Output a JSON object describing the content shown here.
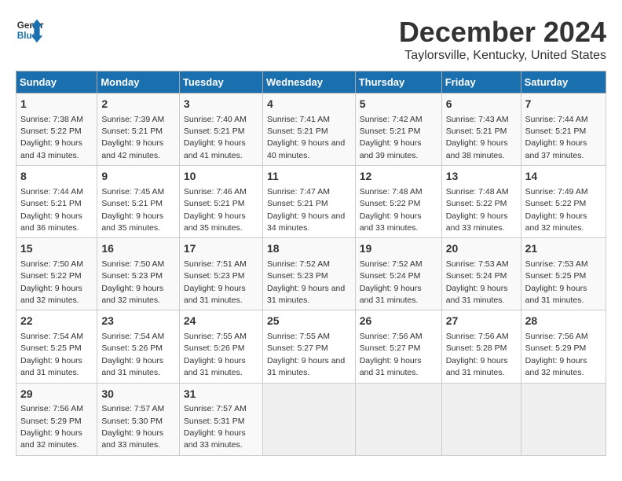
{
  "logo": {
    "text_general": "General",
    "text_blue": "Blue"
  },
  "title": "December 2024",
  "subtitle": "Taylorsville, Kentucky, United States",
  "days_of_week": [
    "Sunday",
    "Monday",
    "Tuesday",
    "Wednesday",
    "Thursday",
    "Friday",
    "Saturday"
  ],
  "weeks": [
    [
      {
        "day": "1",
        "sunrise": "Sunrise: 7:38 AM",
        "sunset": "Sunset: 5:22 PM",
        "daylight": "Daylight: 9 hours and 43 minutes."
      },
      {
        "day": "2",
        "sunrise": "Sunrise: 7:39 AM",
        "sunset": "Sunset: 5:21 PM",
        "daylight": "Daylight: 9 hours and 42 minutes."
      },
      {
        "day": "3",
        "sunrise": "Sunrise: 7:40 AM",
        "sunset": "Sunset: 5:21 PM",
        "daylight": "Daylight: 9 hours and 41 minutes."
      },
      {
        "day": "4",
        "sunrise": "Sunrise: 7:41 AM",
        "sunset": "Sunset: 5:21 PM",
        "daylight": "Daylight: 9 hours and 40 minutes."
      },
      {
        "day": "5",
        "sunrise": "Sunrise: 7:42 AM",
        "sunset": "Sunset: 5:21 PM",
        "daylight": "Daylight: 9 hours and 39 minutes."
      },
      {
        "day": "6",
        "sunrise": "Sunrise: 7:43 AM",
        "sunset": "Sunset: 5:21 PM",
        "daylight": "Daylight: 9 hours and 38 minutes."
      },
      {
        "day": "7",
        "sunrise": "Sunrise: 7:44 AM",
        "sunset": "Sunset: 5:21 PM",
        "daylight": "Daylight: 9 hours and 37 minutes."
      }
    ],
    [
      {
        "day": "8",
        "sunrise": "Sunrise: 7:44 AM",
        "sunset": "Sunset: 5:21 PM",
        "daylight": "Daylight: 9 hours and 36 minutes."
      },
      {
        "day": "9",
        "sunrise": "Sunrise: 7:45 AM",
        "sunset": "Sunset: 5:21 PM",
        "daylight": "Daylight: 9 hours and 35 minutes."
      },
      {
        "day": "10",
        "sunrise": "Sunrise: 7:46 AM",
        "sunset": "Sunset: 5:21 PM",
        "daylight": "Daylight: 9 hours and 35 minutes."
      },
      {
        "day": "11",
        "sunrise": "Sunrise: 7:47 AM",
        "sunset": "Sunset: 5:21 PM",
        "daylight": "Daylight: 9 hours and 34 minutes."
      },
      {
        "day": "12",
        "sunrise": "Sunrise: 7:48 AM",
        "sunset": "Sunset: 5:22 PM",
        "daylight": "Daylight: 9 hours and 33 minutes."
      },
      {
        "day": "13",
        "sunrise": "Sunrise: 7:48 AM",
        "sunset": "Sunset: 5:22 PM",
        "daylight": "Daylight: 9 hours and 33 minutes."
      },
      {
        "day": "14",
        "sunrise": "Sunrise: 7:49 AM",
        "sunset": "Sunset: 5:22 PM",
        "daylight": "Daylight: 9 hours and 32 minutes."
      }
    ],
    [
      {
        "day": "15",
        "sunrise": "Sunrise: 7:50 AM",
        "sunset": "Sunset: 5:22 PM",
        "daylight": "Daylight: 9 hours and 32 minutes."
      },
      {
        "day": "16",
        "sunrise": "Sunrise: 7:50 AM",
        "sunset": "Sunset: 5:23 PM",
        "daylight": "Daylight: 9 hours and 32 minutes."
      },
      {
        "day": "17",
        "sunrise": "Sunrise: 7:51 AM",
        "sunset": "Sunset: 5:23 PM",
        "daylight": "Daylight: 9 hours and 31 minutes."
      },
      {
        "day": "18",
        "sunrise": "Sunrise: 7:52 AM",
        "sunset": "Sunset: 5:23 PM",
        "daylight": "Daylight: 9 hours and 31 minutes."
      },
      {
        "day": "19",
        "sunrise": "Sunrise: 7:52 AM",
        "sunset": "Sunset: 5:24 PM",
        "daylight": "Daylight: 9 hours and 31 minutes."
      },
      {
        "day": "20",
        "sunrise": "Sunrise: 7:53 AM",
        "sunset": "Sunset: 5:24 PM",
        "daylight": "Daylight: 9 hours and 31 minutes."
      },
      {
        "day": "21",
        "sunrise": "Sunrise: 7:53 AM",
        "sunset": "Sunset: 5:25 PM",
        "daylight": "Daylight: 9 hours and 31 minutes."
      }
    ],
    [
      {
        "day": "22",
        "sunrise": "Sunrise: 7:54 AM",
        "sunset": "Sunset: 5:25 PM",
        "daylight": "Daylight: 9 hours and 31 minutes."
      },
      {
        "day": "23",
        "sunrise": "Sunrise: 7:54 AM",
        "sunset": "Sunset: 5:26 PM",
        "daylight": "Daylight: 9 hours and 31 minutes."
      },
      {
        "day": "24",
        "sunrise": "Sunrise: 7:55 AM",
        "sunset": "Sunset: 5:26 PM",
        "daylight": "Daylight: 9 hours and 31 minutes."
      },
      {
        "day": "25",
        "sunrise": "Sunrise: 7:55 AM",
        "sunset": "Sunset: 5:27 PM",
        "daylight": "Daylight: 9 hours and 31 minutes."
      },
      {
        "day": "26",
        "sunrise": "Sunrise: 7:56 AM",
        "sunset": "Sunset: 5:27 PM",
        "daylight": "Daylight: 9 hours and 31 minutes."
      },
      {
        "day": "27",
        "sunrise": "Sunrise: 7:56 AM",
        "sunset": "Sunset: 5:28 PM",
        "daylight": "Daylight: 9 hours and 31 minutes."
      },
      {
        "day": "28",
        "sunrise": "Sunrise: 7:56 AM",
        "sunset": "Sunset: 5:29 PM",
        "daylight": "Daylight: 9 hours and 32 minutes."
      }
    ],
    [
      {
        "day": "29",
        "sunrise": "Sunrise: 7:56 AM",
        "sunset": "Sunset: 5:29 PM",
        "daylight": "Daylight: 9 hours and 32 minutes."
      },
      {
        "day": "30",
        "sunrise": "Sunrise: 7:57 AM",
        "sunset": "Sunset: 5:30 PM",
        "daylight": "Daylight: 9 hours and 33 minutes."
      },
      {
        "day": "31",
        "sunrise": "Sunrise: 7:57 AM",
        "sunset": "Sunset: 5:31 PM",
        "daylight": "Daylight: 9 hours and 33 minutes."
      },
      null,
      null,
      null,
      null
    ]
  ]
}
